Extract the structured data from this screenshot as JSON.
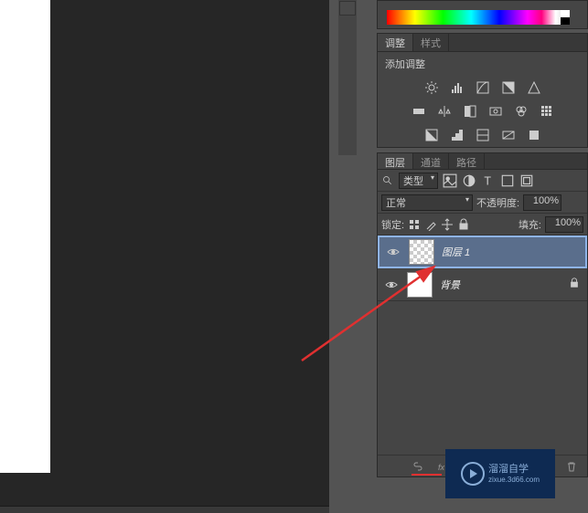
{
  "panels": {
    "adjust": {
      "tab_adjust": "调整",
      "tab_style": "样式",
      "add_label": "添加调整"
    },
    "layers": {
      "tab_layers": "图层",
      "tab_channels": "通道",
      "tab_paths": "路径",
      "filter_type": "类型",
      "blend_mode": "正常",
      "opacity_label": "不透明度:",
      "opacity_value": "100%",
      "lock_label": "锁定:",
      "fill_label": "填充:",
      "fill_value": "100%",
      "items": [
        {
          "name": "图层 1",
          "selected": true,
          "transparent": true,
          "locked": false
        },
        {
          "name": "背景",
          "selected": false,
          "transparent": false,
          "locked": true
        }
      ]
    }
  },
  "watermark": {
    "title": "溜溜自学",
    "subtitle": "zixue.3d66.com"
  }
}
